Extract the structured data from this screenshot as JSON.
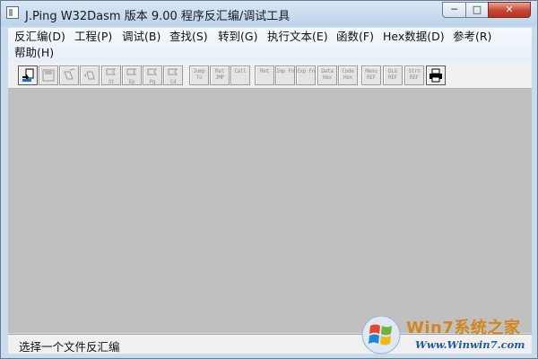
{
  "window": {
    "title": "J.Ping W32Dasm 版本 9.00 程序反汇编/调试工具",
    "controls": {
      "minimize": "─",
      "maximize": "□",
      "close": "✕"
    }
  },
  "menu": [
    "反汇编(D)",
    "工程(P)",
    "调试(B)",
    "查找(S)",
    "转到(G)",
    "执行文本(E)",
    "函数(F)",
    "Hex数据(D)",
    "参考(R)",
    "帮助(H)"
  ],
  "toolbar": {
    "buttons": [
      {
        "name": "open-disasm-button",
        "icon": "open-file-icon",
        "active": true
      },
      {
        "name": "save-button",
        "icon": "save-disk-icon",
        "active": false
      },
      {
        "name": "find-button",
        "icon": "flashlight-icon",
        "active": false
      },
      {
        "name": "find-next-button",
        "icon": "flashlight-next-icon",
        "active": false
      },
      {
        "name": "goto-start-button",
        "icon": "flag-start-icon",
        "active": false,
        "label": "St"
      },
      {
        "name": "goto-entry-button",
        "icon": "flag-entry-icon",
        "active": false,
        "label": "Ep"
      },
      {
        "name": "goto-page-button",
        "icon": "flag-page-icon",
        "active": false,
        "label": "Pg"
      },
      {
        "name": "goto-code-button",
        "icon": "flag-code-icon",
        "active": false,
        "label": "Cd"
      },
      {
        "name": "jump-to-button",
        "icon": "jump-icon",
        "active": false,
        "label": "Jump To"
      },
      {
        "name": "ret-jmp-button",
        "icon": "ret-icon",
        "active": false,
        "label": "Ret JMP"
      },
      {
        "name": "call-button",
        "icon": "call-icon",
        "active": false,
        "label": "Call"
      },
      {
        "name": "ret-button",
        "icon": "ret-icon",
        "active": false,
        "label": "Ret"
      },
      {
        "name": "imp-fn-button",
        "icon": "import-icon",
        "active": false,
        "label": "Imp Fn"
      },
      {
        "name": "exp-fn-button",
        "icon": "export-icon",
        "active": false,
        "label": "Exp Fn"
      },
      {
        "name": "data-hex-button",
        "icon": "data-icon",
        "active": false,
        "label": "Data Hex"
      },
      {
        "name": "code-hex-button",
        "icon": "code-icon",
        "active": false,
        "label": "Code Hex"
      },
      {
        "name": "menu-ref-button",
        "icon": "menu-ref-icon",
        "active": false,
        "label": "Menu REF"
      },
      {
        "name": "dlg-ref-button",
        "icon": "dialog-ref-icon",
        "active": false,
        "label": "DLG REF"
      },
      {
        "name": "strn-ref-button",
        "icon": "string-ref-icon",
        "active": false,
        "label": "Strn REF"
      },
      {
        "name": "print-button",
        "icon": "printer-icon",
        "active": true
      }
    ]
  },
  "status": {
    "text": "选择一个文件反汇编"
  },
  "watermark": {
    "brand": "Win7系统之家",
    "url": "Www.Winwin7.com"
  },
  "colors": {
    "client_bg": "#c0c0c0",
    "title_bar": "#c9dcef",
    "close_red": "#c8452f"
  }
}
